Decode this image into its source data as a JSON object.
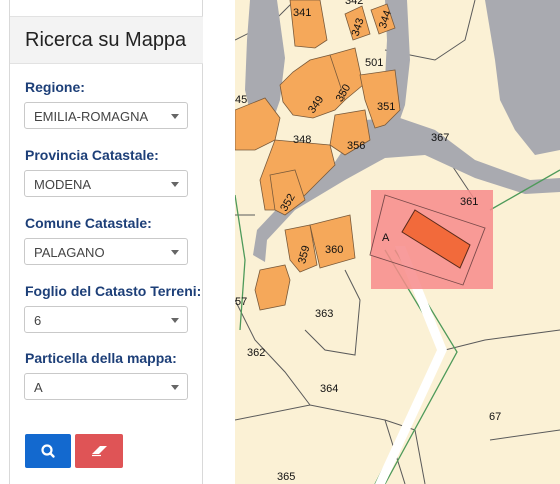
{
  "panel": {
    "title": "Ricerca su Mappa",
    "fields": [
      {
        "label": "Regione:",
        "value": "EMILIA-ROMAGNA"
      },
      {
        "label": "Provincia Catastale:",
        "value": "MODENA"
      },
      {
        "label": "Comune Catastale:",
        "value": "PALAGANO"
      },
      {
        "label": "Foglio del Catasto Terreni:",
        "value": "6"
      },
      {
        "label": "Particella della mappa:",
        "value": "A"
      }
    ],
    "search_icon": "search-icon",
    "eraser_icon": "eraser-icon",
    "colors": {
      "accent": "#1369cf",
      "danger": "#df5456",
      "label": "#1d3f78"
    }
  },
  "map": {
    "parcels": [
      "341",
      "342",
      "343",
      "344",
      "501",
      "350",
      "349",
      "351",
      "45",
      "348",
      "356",
      "367",
      "352",
      "361",
      "A",
      "359",
      "360",
      "57",
      "363",
      "362",
      "364",
      "67",
      "365"
    ],
    "colors": {
      "land": "#fbf1d5",
      "building": "#f5a85a",
      "road": "#a9aab0",
      "highlight": "#f26a3b",
      "selection": "#f78b8b"
    }
  }
}
